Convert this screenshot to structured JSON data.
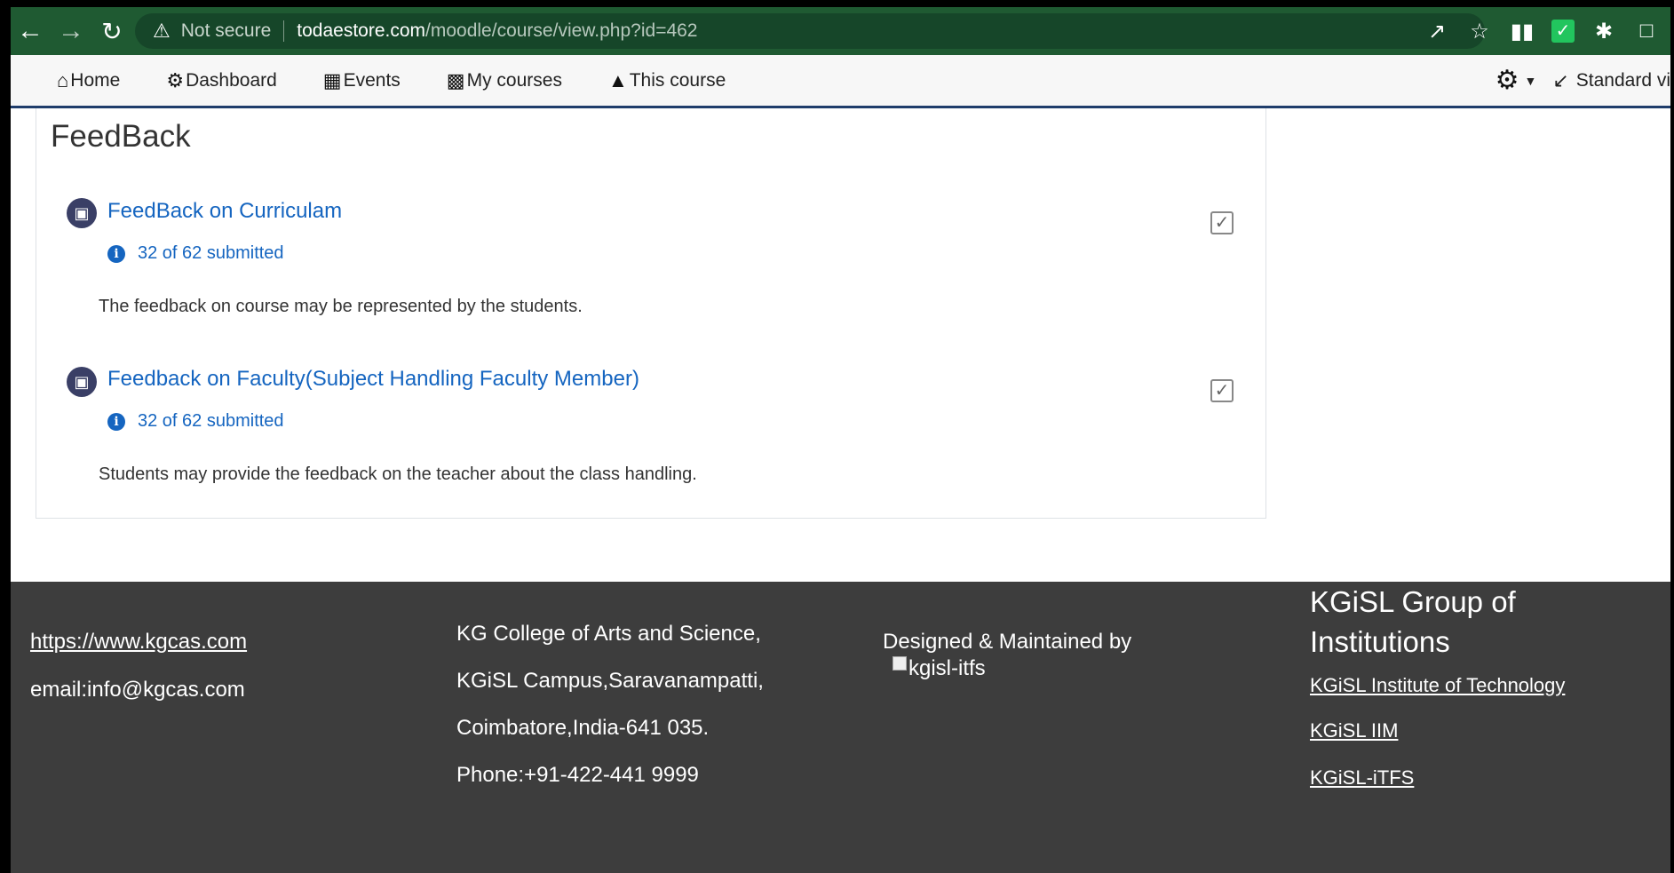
{
  "browser": {
    "not_secure": "Not secure",
    "url_host": "todaestore.com",
    "url_path": "/moodle/course/view.php?id=462"
  },
  "navbar": {
    "items": [
      {
        "label": "Home",
        "icon": "home-icon"
      },
      {
        "label": "Dashboard",
        "icon": "dashboard-icon"
      },
      {
        "label": "Events",
        "icon": "calendar-icon"
      },
      {
        "label": "My courses",
        "icon": "briefcase-icon"
      },
      {
        "label": "This course",
        "icon": "sitemap-icon"
      }
    ],
    "view_mode": "Standard vi"
  },
  "section": {
    "title": "FeedBack",
    "activities": [
      {
        "name": "FeedBack on Curriculam",
        "info": "32 of 62 submitted",
        "description": "The feedback on course may be represented by the students."
      },
      {
        "name": "Feedback on Faculty(Subject Handling Faculty Member)",
        "info": "32 of 62 submitted",
        "description": "Students may provide the feedback on the teacher about the class handling."
      }
    ]
  },
  "footer": {
    "website": "https://www.kgcas.com",
    "email": "email:info@kgcas.com",
    "address": [
      "KG College of Arts and Science,",
      "KGiSL Campus,Saravanampatti,",
      "Coimbatore,India-641 035.",
      "Phone:+91-422-441 9999"
    ],
    "designed_by": "Designed & Maintained by",
    "designer_logo_alt": "kgisl-itfs",
    "group_heading_line1": "KGiSL Group of",
    "group_heading_line2": "Institutions",
    "group_links": [
      "KGiSL Institute of Technology",
      "KGiSL IIM",
      "KGiSL-iTFS"
    ]
  },
  "colors": {
    "browser_bar": "#1f5a32",
    "link_blue": "#1565c0",
    "footer_bg": "#3d3d3d",
    "navbar_border": "#1f3d6b"
  }
}
